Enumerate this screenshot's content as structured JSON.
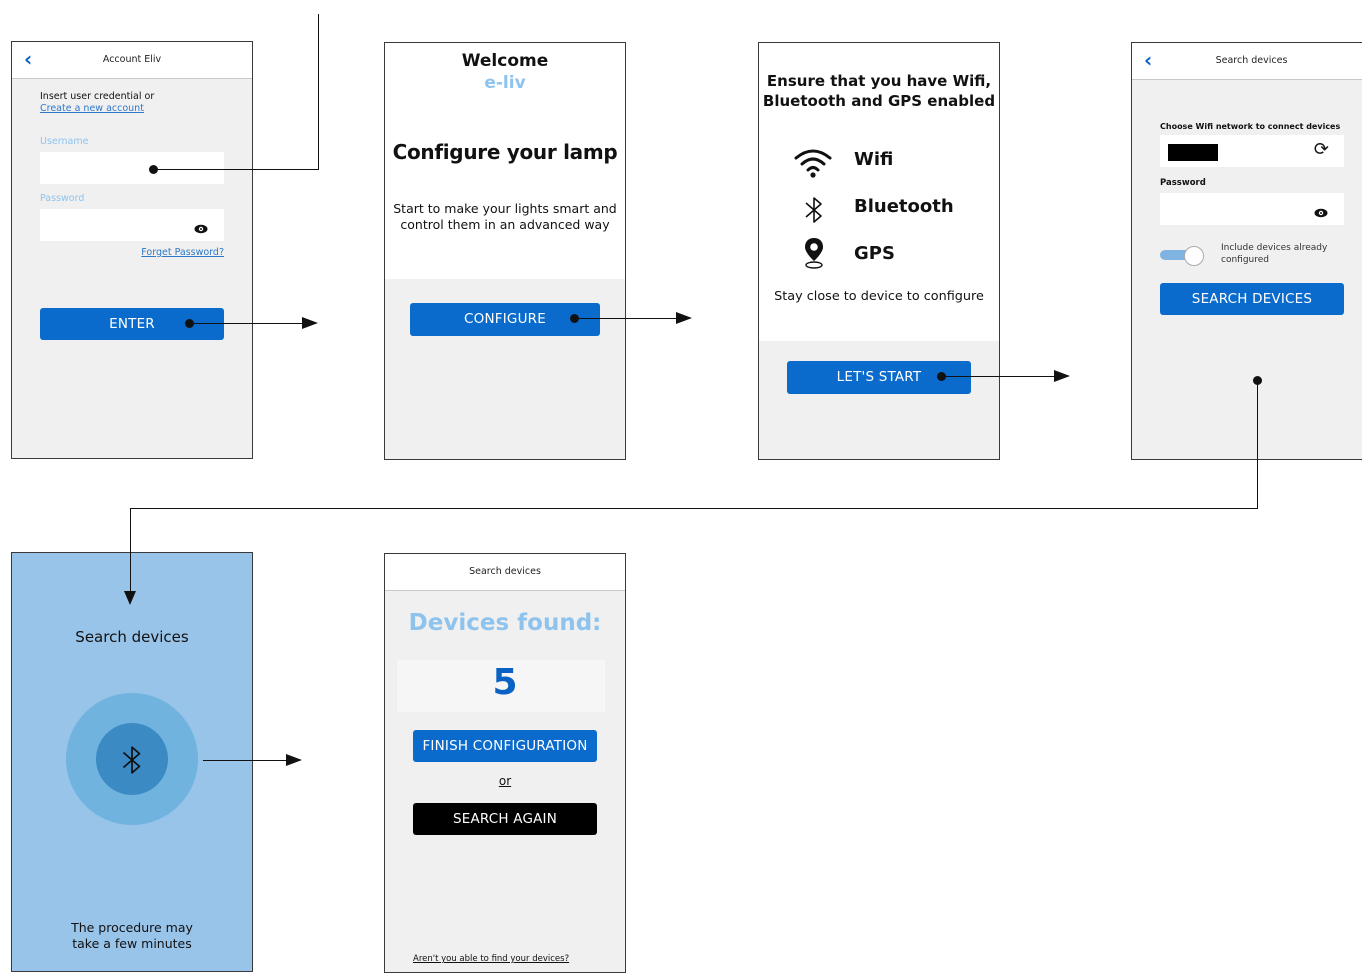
{
  "colors": {
    "primary_blue": "#0a6bcc",
    "light_blue_text": "#8ec3ee",
    "search_screen_bg": "#99c4ea",
    "pulse_outer": "#6fb3de",
    "pulse_inner": "#3c8ac4",
    "count_blue": "#0a63c4"
  },
  "login": {
    "header_title": "Account Eliv",
    "intro_text": "Insert user credential or",
    "create_link": "Create a new account",
    "username_label": "Username",
    "password_label": "Password",
    "forgot_link": "Forget Password?",
    "enter_button": "ENTER",
    "icons": [
      "back-chevron-icon",
      "eye-icon"
    ]
  },
  "welcome": {
    "title": "Welcome",
    "brand": "e-liv",
    "heading": "Configure your lamp",
    "description": "Start to make your lights smart and control them in an advanced way",
    "configure_button": "CONFIGURE"
  },
  "requirements": {
    "heading": "Ensure that you have Wifi, Bluetooth and GPS enabled",
    "items": [
      {
        "icon": "wifi-icon",
        "label": "Wifi"
      },
      {
        "icon": "bluetooth-icon",
        "label": "Bluetooth"
      },
      {
        "icon": "location-pin-icon",
        "label": "GPS"
      }
    ],
    "hint": "Stay close to device to configure",
    "start_button": "LET'S START"
  },
  "wifi_setup": {
    "header_title": "Search devices",
    "network_label": "Choose Wifi network to connect devices",
    "password_label": "Password",
    "toggle_label": "Include devices already configured",
    "search_button": "SEARCH DEVICES",
    "icons": [
      "back-chevron-icon",
      "refresh-icon",
      "eye-icon"
    ]
  },
  "searching": {
    "title": "Search devices",
    "footer": "The procedure may take a few minutes",
    "icon": "bluetooth-icon"
  },
  "results": {
    "header_title": "Search devices",
    "heading": "Devices found:",
    "count": "5",
    "finish_button": "FINISH CONFIGURATION",
    "or_text": "or",
    "search_again_button": "SEARCH AGAIN",
    "help_link": "Aren't you able to find your devices?"
  }
}
